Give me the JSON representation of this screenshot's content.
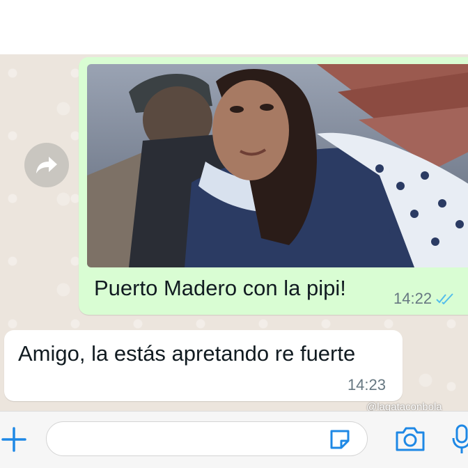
{
  "colors": {
    "chat_background": "#ece5dd",
    "outgoing_bubble": "#d9fdd3",
    "incoming_bubble": "#ffffff",
    "accent_blue": "#1e88e5",
    "read_ticks": "#53bdeb",
    "meta_text": "#667781"
  },
  "forward": {
    "icon": "forward-arrow-icon"
  },
  "messages": [
    {
      "direction": "outgoing",
      "has_photo": true,
      "text": "Puerto Madero con la pipi!",
      "time": "14:22",
      "status_icon": "double-check-read-icon"
    },
    {
      "direction": "incoming",
      "text": "Amigo, la estás apretando re fuerte",
      "time": "14:23"
    }
  ],
  "watermark": "@lagataconbola",
  "input_bar": {
    "plus_icon": "plus-icon",
    "placeholder": "",
    "sticker_icon": "sticker-icon",
    "camera_icon": "camera-icon",
    "mic_icon": "microphone-icon"
  }
}
